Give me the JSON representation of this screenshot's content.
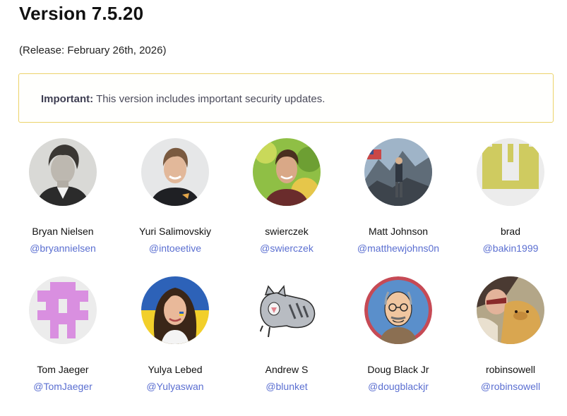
{
  "header": {
    "title": "Version 7.5.20",
    "release": "(Release: February 26th, 2026)"
  },
  "notice": {
    "label": "Important:",
    "text": " This version includes important security updates."
  },
  "contributors": [
    {
      "name": "Bryan Nielsen",
      "handle": "@bryannielsen"
    },
    {
      "name": "Yuri Salimovskiy",
      "handle": "@intoeetive"
    },
    {
      "name": "swierczek",
      "handle": "@swierczek"
    },
    {
      "name": "Matt Johnson",
      "handle": "@matthewjohns0n"
    },
    {
      "name": "brad",
      "handle": "@bakin1999"
    },
    {
      "name": "Tom Jaeger",
      "handle": "@TomJaeger"
    },
    {
      "name": "Yulya Lebed",
      "handle": "@Yulyaswan"
    },
    {
      "name": "Andrew S",
      "handle": "@blunket"
    },
    {
      "name": "Doug Black Jr",
      "handle": "@dougblackjr"
    },
    {
      "name": "robinsowell",
      "handle": "@robinsowell"
    }
  ],
  "colors": {
    "link": "#5b6fd1",
    "notice_border": "#ecd36a"
  }
}
